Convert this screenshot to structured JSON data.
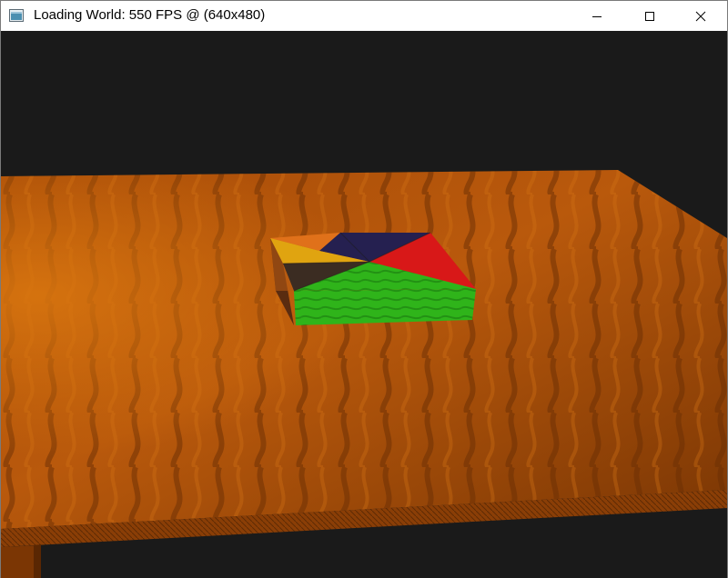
{
  "window": {
    "title": "Loading World: 550 FPS @ (640x480)",
    "app_icon": "opengl-window-icon",
    "controls": {
      "minimize": "minimize-icon",
      "maximize": "maximize-icon",
      "close": "close-icon"
    }
  },
  "scene": {
    "background_color": "#1a1a1a",
    "table_color": "#b8560a",
    "box_face_colors": {
      "orange": "#e0711a",
      "navy": "#252050",
      "red": "#d81818",
      "yellow": "#e0a410",
      "dark": "#3b2c22",
      "green": "#2fb41a"
    }
  }
}
